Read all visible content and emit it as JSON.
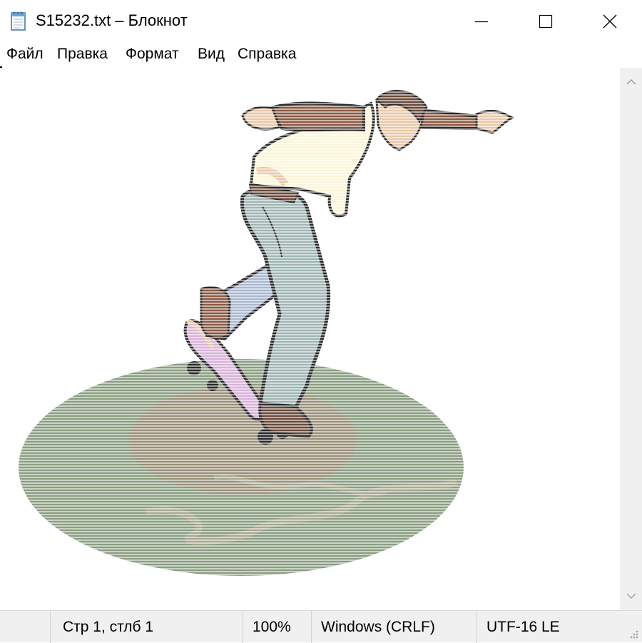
{
  "window": {
    "title": "S15232.txt – Блокнот",
    "controls": {
      "minimize": "minimize-icon",
      "maximize": "maximize-icon",
      "close": "close-icon"
    }
  },
  "menu": {
    "items": [
      {
        "label": "Файл"
      },
      {
        "label": "Правка"
      },
      {
        "label": "Формат"
      },
      {
        "label": "Вид"
      },
      {
        "label": "Справка"
      }
    ]
  },
  "status": {
    "position": "Стр 1, стлб 1",
    "zoom": "100%",
    "line_endings": "Windows (CRLF)",
    "encoding": "UTF-16 LE"
  },
  "colors": {
    "ground_outer": "#8a9e80",
    "ground_inner": "#9a9078",
    "jacket": "#8a5a44",
    "shirt": "#fbf6d9",
    "jeans": "#9fb5b3",
    "board": "#d8b2d8",
    "outline": "#2a2a2a"
  }
}
